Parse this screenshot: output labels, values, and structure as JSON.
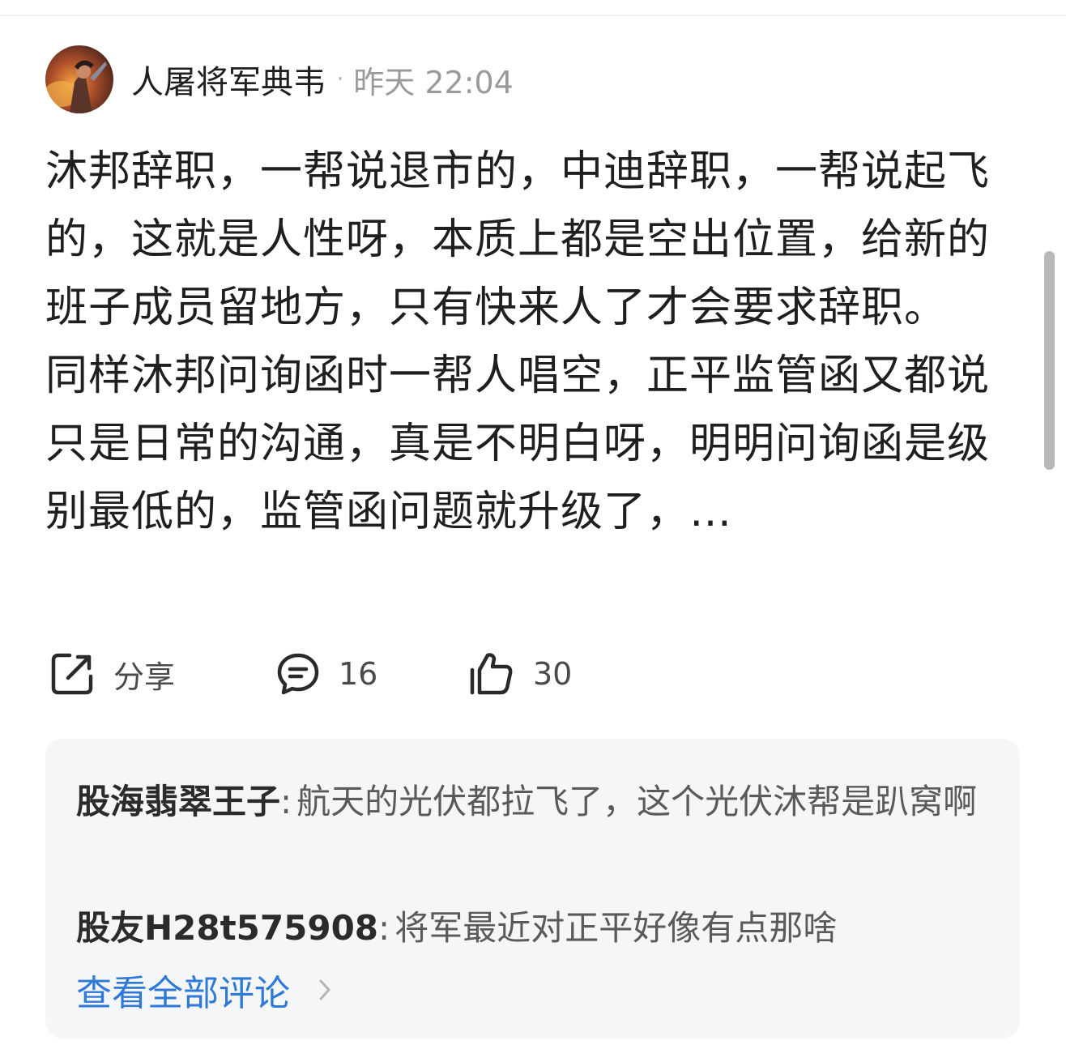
{
  "post": {
    "author": "人屠将军典韦",
    "separator": "·",
    "time": "昨天 22:04",
    "paragraph1": "沐邦辞职，一帮说退市的，中迪辞职，一帮说起飞的，这就是人性呀，本质上都是空出位置，给新的班子成员留地方，只有快来人了才会要求辞职。",
    "paragraph2": "同样沐邦问询函时一帮人唱空，正平监管函又都说只是日常的沟通，真是不明白呀，明明问询函是级别最低的，监管函问题就升级了，…"
  },
  "actions": {
    "share_label": "分享",
    "share_icon": "share-icon",
    "comment_count": "16",
    "comment_icon": "comment-bubble-icon",
    "like_count": "30",
    "like_icon": "thumbs-up-icon"
  },
  "comments": [
    {
      "user": "股海翡翠王子",
      "colon": ":",
      "text": "航天的光伏都拉飞了，这个光伏沐帮是趴窝啊"
    },
    {
      "user": "股友H28t575908",
      "colon": ":",
      "text": "将军最近对正平好像有点那啥"
    }
  ],
  "view_all": {
    "label": "查看全部评论",
    "icon": "chevron-right-icon"
  },
  "colors": {
    "link_blue": "#2e7ad6",
    "comment_bg": "#f5f6f8",
    "muted_text": "#9a9a9a"
  }
}
